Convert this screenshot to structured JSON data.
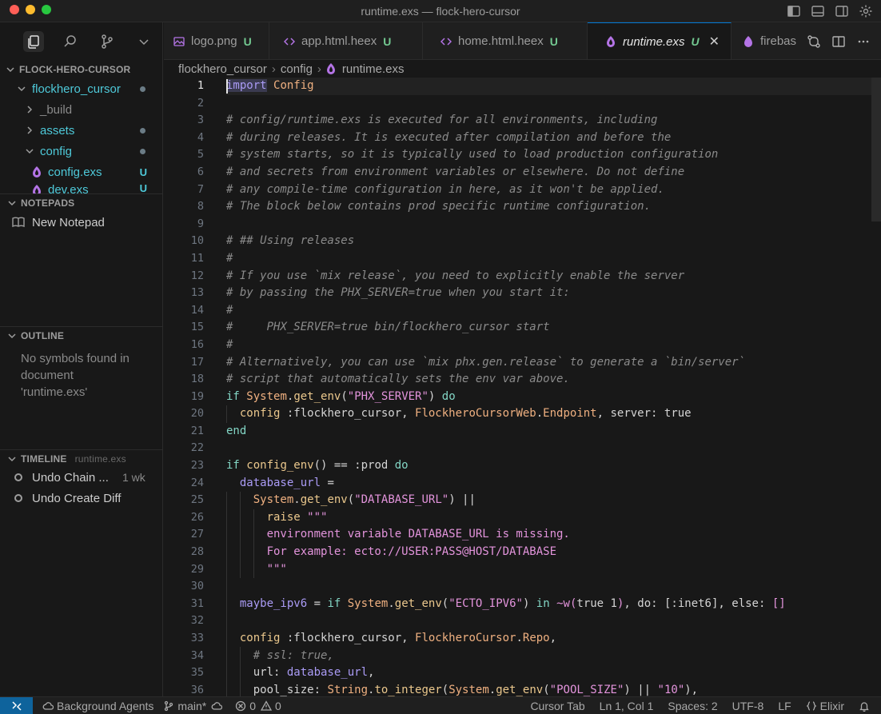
{
  "window": {
    "title": "runtime.exs — flock-hero-cursor"
  },
  "sidebar": {
    "explorer_header": "FLOCK-HERO-CURSOR",
    "tree": [
      {
        "label": "flockhero_cursor",
        "type": "folder-open",
        "badge": "dot"
      },
      {
        "label": "_build",
        "type": "folder-closed",
        "badge": ""
      },
      {
        "label": "assets",
        "type": "folder-closed",
        "badge": "dot"
      },
      {
        "label": "config",
        "type": "folder-open",
        "badge": "dot"
      },
      {
        "label": "config.exs",
        "type": "file",
        "badge": "U"
      },
      {
        "label": "dev.exs",
        "type": "file",
        "badge": "U"
      }
    ],
    "notepads_header": "NOTEPADS",
    "new_notepad": "New Notepad",
    "outline_header": "OUTLINE",
    "outline_empty": "No symbols found in document 'runtime.exs'",
    "timeline_header": "TIMELINE",
    "timeline_sub": "runtime.exs",
    "timeline": [
      {
        "label": "Undo Chain ...",
        "time": "1 wk"
      },
      {
        "label": "Undo Create Diff",
        "time": ""
      }
    ]
  },
  "tabs": [
    {
      "label": "logo.png",
      "status": "U",
      "icon": "image-icon"
    },
    {
      "label": "app.html.heex",
      "status": "U",
      "icon": "code-icon"
    },
    {
      "label": "home.html.heex",
      "status": "U",
      "icon": "code-icon"
    },
    {
      "label": "runtime.exs",
      "status": "U",
      "icon": "elixir-icon",
      "active": true
    },
    {
      "label": "firebas",
      "status": "",
      "icon": "elixir-icon"
    }
  ],
  "breadcrumb": [
    "flockhero_cursor",
    "config",
    "runtime.exs"
  ],
  "editor": {
    "current_line": 1,
    "line_numbers": [
      "1",
      "2",
      "3",
      "4",
      "5",
      "6",
      "7",
      "8",
      "9",
      "10",
      "11",
      "12",
      "13",
      "14",
      "15",
      "16",
      "17",
      "18",
      "19",
      "20",
      "21",
      "22",
      "23",
      "24",
      "25",
      "26",
      "27",
      "28",
      "29",
      "30",
      "31",
      "32",
      "33",
      "34",
      "35",
      "36"
    ]
  },
  "statusbar": {
    "agents": "Background Agents",
    "branch": "main*",
    "errors": "0",
    "warnings": "0",
    "cursor_tab": "Cursor Tab",
    "position": "Ln 1, Col 1",
    "spaces": "Spaces: 2",
    "encoding": "UTF-8",
    "eol": "LF",
    "language": "Elixir"
  },
  "colors": {
    "accent": "#0e639c",
    "untracked": "#73c991",
    "tree_text": "#4ec9d9",
    "elixir": "#b474e6"
  }
}
